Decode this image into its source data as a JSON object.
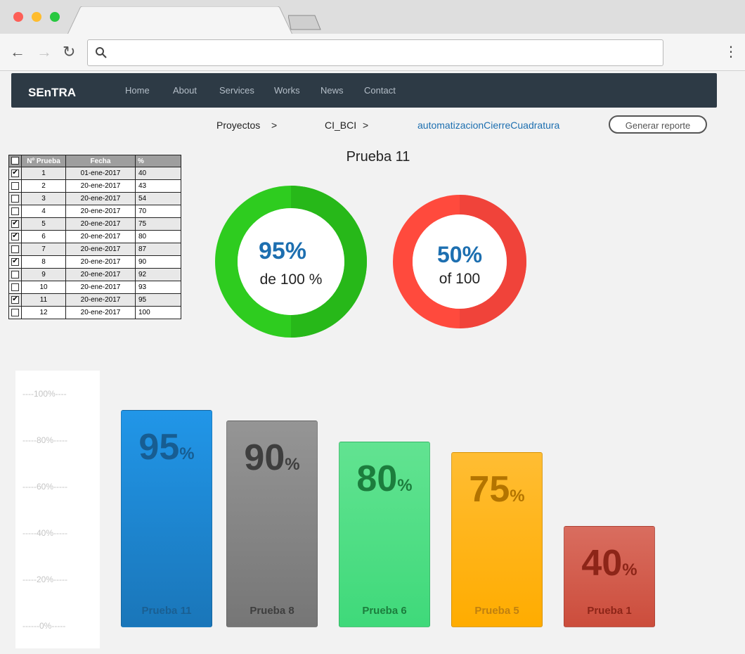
{
  "navbar": {
    "brand": "SEnTRA",
    "links": [
      "Home",
      "About",
      "Services",
      "Works",
      "News",
      "Contact"
    ]
  },
  "breadcrumb": {
    "items": [
      "Proyectos",
      "CI_BCI",
      "automatizacionCierreCuadratura"
    ],
    "separator": ">",
    "report_button": "Generar reporte"
  },
  "table": {
    "headers": [
      "Nº Prueba",
      "Fecha",
      "%"
    ],
    "rows": [
      {
        "checked": true,
        "n": "1",
        "fecha": "01-ene-2017",
        "pct": "40"
      },
      {
        "checked": false,
        "n": "2",
        "fecha": "20-ene-2017",
        "pct": "43"
      },
      {
        "checked": false,
        "n": "3",
        "fecha": "20-ene-2017",
        "pct": "54"
      },
      {
        "checked": false,
        "n": "4",
        "fecha": "20-ene-2017",
        "pct": "70"
      },
      {
        "checked": true,
        "n": "5",
        "fecha": "20-ene-2017",
        "pct": "75"
      },
      {
        "checked": true,
        "n": "6",
        "fecha": "20-ene-2017",
        "pct": "80"
      },
      {
        "checked": false,
        "n": "7",
        "fecha": "20-ene-2017",
        "pct": "87"
      },
      {
        "checked": true,
        "n": "8",
        "fecha": "20-ene-2017",
        "pct": "90"
      },
      {
        "checked": false,
        "n": "9",
        "fecha": "20-ene-2017",
        "pct": "92"
      },
      {
        "checked": false,
        "n": "10",
        "fecha": "20-ene-2017",
        "pct": "93"
      },
      {
        "checked": true,
        "n": "11",
        "fecha": "20-ene-2017",
        "pct": "95"
      },
      {
        "checked": false,
        "n": "12",
        "fecha": "20-ene-2017",
        "pct": "100"
      }
    ]
  },
  "donuts": {
    "title": "Prueba 11",
    "items": [
      {
        "value": "95%",
        "caption": "de 100 %",
        "fraction": 0.95,
        "color": "#2ecc1f",
        "shade": "#27b819"
      },
      {
        "value": "50%",
        "caption": "of 100",
        "fraction": 0.5,
        "color": "#ff4a3d",
        "shade": "#f0433a"
      }
    ]
  },
  "chart_data": {
    "type": "bar",
    "categories": [
      "Prueba 11",
      "Prueba 8",
      "Prueba 6",
      "Prueba 5",
      "Prueba 1"
    ],
    "values": [
      95,
      90,
      80,
      75,
      40
    ],
    "unit": "%",
    "ylim": [
      0,
      100
    ],
    "yticks": [
      "----100%----",
      "-----80%-----",
      "-----60%-----",
      "-----40%-----",
      "-----20%-----",
      "------0%-----"
    ],
    "colors": [
      {
        "top": "#2196e8",
        "bottom": "#1a76b9",
        "num": "#175d92",
        "label": "#1a5f92"
      },
      {
        "top": "#959595",
        "bottom": "#767676",
        "num": "#3e3e3e",
        "label": "#3e3e3e"
      },
      {
        "top": "#62e391",
        "bottom": "#3fd97a",
        "num": "#1c7d3d",
        "label": "#1c7d3d"
      },
      {
        "top": "#ffbd33",
        "bottom": "#ffac00",
        "num": "#b37400",
        "label": "#c08010"
      },
      {
        "top": "#d96d5f",
        "bottom": "#cc4d3c",
        "num": "#8d2518",
        "label": "#8d2518"
      }
    ]
  }
}
